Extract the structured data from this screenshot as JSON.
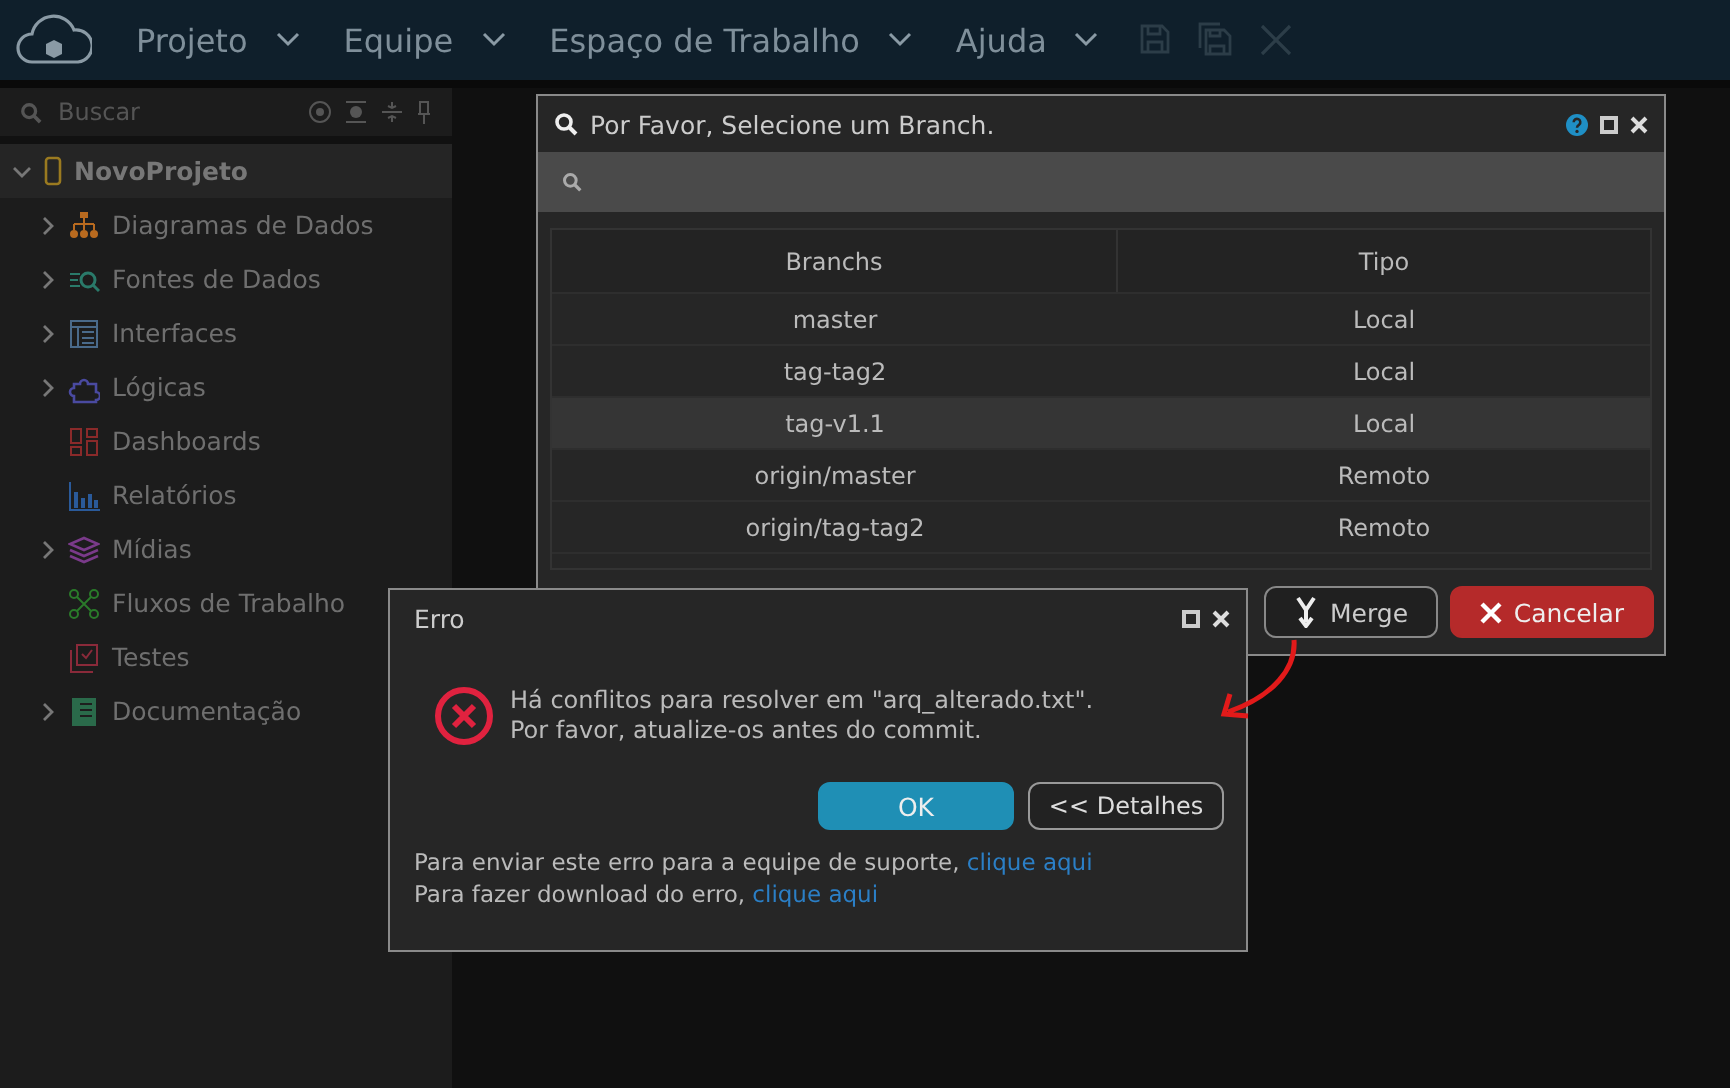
{
  "menu": [
    {
      "label": "Projeto"
    },
    {
      "label": "Equipe"
    },
    {
      "label": "Espaço de Trabalho"
    },
    {
      "label": "Ajuda"
    }
  ],
  "toolbar": [
    {
      "kind": "save",
      "disabled": true
    },
    {
      "kind": "save-all",
      "disabled": true
    },
    {
      "kind": "close",
      "disabled": true
    }
  ],
  "sidebar": {
    "search": {
      "placeholder": "Buscar"
    },
    "tree": [
      {
        "label": "NovoProjeto",
        "expanded": true,
        "children": [
          {
            "label": "Diagramas de Dados",
            "kind": "diagram",
            "expandable": true
          },
          {
            "label": "Fontes de Dados",
            "kind": "source",
            "expandable": true
          },
          {
            "label": "Interfaces",
            "kind": "interface",
            "expandable": true
          },
          {
            "label": "Lógicas",
            "kind": "logic",
            "expandable": true
          },
          {
            "label": "Dashboards",
            "kind": "dashboard",
            "expandable": false
          },
          {
            "label": "Relatórios",
            "kind": "report",
            "expandable": false
          },
          {
            "label": "Mídias",
            "kind": "media",
            "expandable": true
          },
          {
            "label": "Fluxos de Trabalho",
            "kind": "flow",
            "expandable": false
          },
          {
            "label": "Testes",
            "kind": "test",
            "expandable": false
          },
          {
            "label": "Documentação",
            "kind": "doc",
            "expandable": true
          }
        ]
      }
    ]
  },
  "branch_dialog": {
    "title": "Por Favor, Selecione um Branch.",
    "columns": [
      "Branchs",
      "Tipo"
    ],
    "rows": [
      {
        "cells": [
          "master",
          "Local"
        ],
        "selected": false
      },
      {
        "cells": [
          "tag-tag2",
          "Local"
        ],
        "selected": false
      },
      {
        "cells": [
          "tag-v1.1",
          "Local"
        ],
        "selected": true
      },
      {
        "cells": [
          "origin/master",
          "Remoto"
        ],
        "selected": false
      },
      {
        "cells": [
          "origin/tag-tag2",
          "Remoto"
        ],
        "selected": false
      }
    ],
    "buttons": [
      {
        "label": "Merge",
        "kind": "merge"
      },
      {
        "label": "Cancelar",
        "kind": "cancel"
      }
    ]
  },
  "error_dialog": {
    "title": "Erro",
    "message": [
      "Há conflitos para resolver em \"arq_alterado.txt\".",
      "Por favor, atualize-os antes do commit."
    ],
    "buttons": [
      {
        "label": "OK",
        "kind": "primary"
      },
      {
        "label": "<< Detalhes",
        "kind": "secondary"
      }
    ],
    "links": [
      {
        "text": "Para enviar este erro para a equipe de suporte, ",
        "link": "clique aqui"
      },
      {
        "text": "Para fazer download do erro, ",
        "link": "clique aqui"
      }
    ]
  }
}
